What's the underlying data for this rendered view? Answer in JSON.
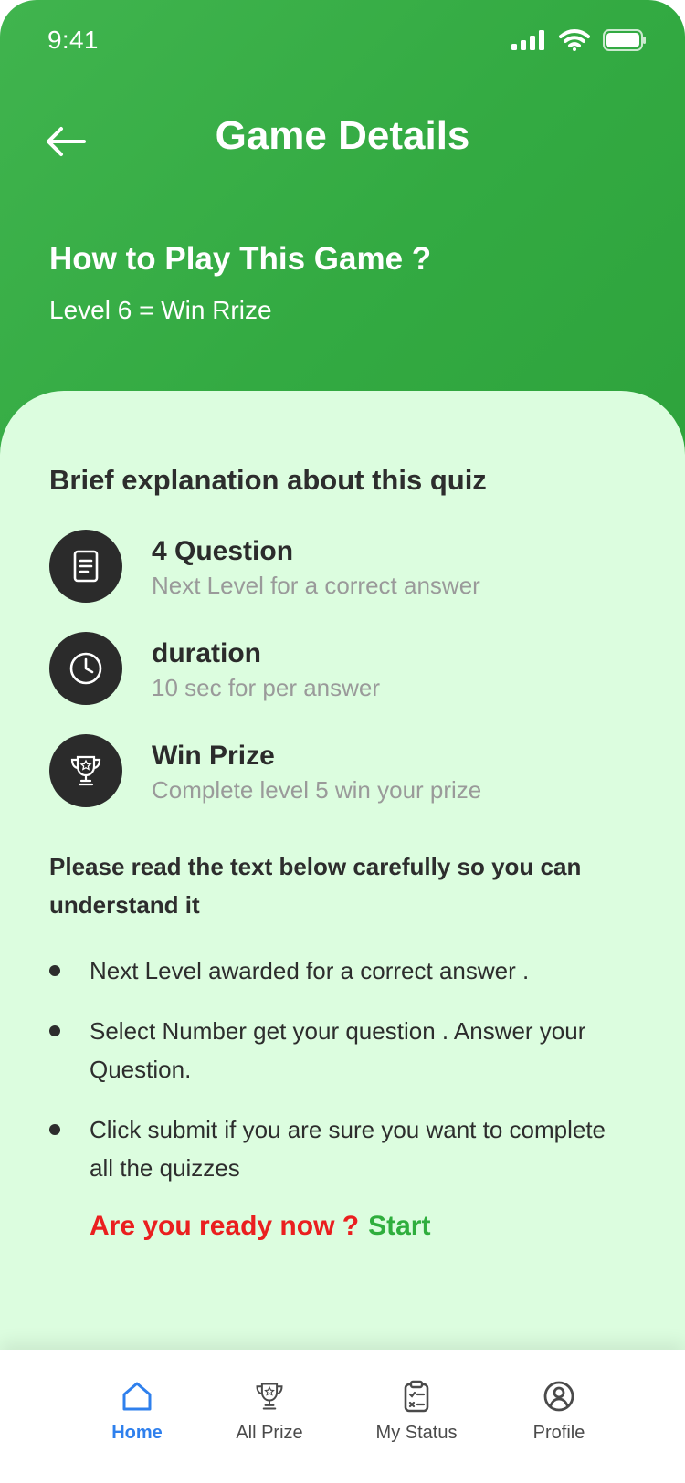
{
  "status_bar": {
    "time": "9:41",
    "icons": [
      "signal-icon",
      "wifi-icon",
      "battery-icon"
    ]
  },
  "header": {
    "back_icon": "arrow-left-icon",
    "title": "Game Details"
  },
  "hero": {
    "title": "How to Play This Game ?",
    "subtitle": "Level 6 = Win Rrize"
  },
  "content": {
    "section_title": "Brief explanation about this quiz",
    "features": [
      {
        "icon": "document-icon",
        "title": "4 Question",
        "description": "Next Level  for a correct answer"
      },
      {
        "icon": "clock-icon",
        "title": "duration",
        "description": "10 sec for per answer"
      },
      {
        "icon": "trophy-icon",
        "title": "Win Prize",
        "description": "Complete level 5 win your prize"
      }
    ],
    "rules_intro": "Please read the text below carefully so you can understand it",
    "rules": [
      "Next Level awarded for a correct answer .",
      "Select Number get your question . Answer your Question.",
      "Click submit if you are sure you want to complete all the quizzes"
    ],
    "cta": {
      "question": "Are you ready now ?",
      "start": "Start"
    }
  },
  "bottom_nav": {
    "active": "Home",
    "items": [
      {
        "label": "Home",
        "icon": "home-icon"
      },
      {
        "label": "All Prize",
        "icon": "trophy-icon"
      },
      {
        "label": "My Status",
        "icon": "clipboard-icon"
      },
      {
        "label": "Profile",
        "icon": "user-circle-icon"
      }
    ]
  },
  "colors": {
    "header_green": "#33aa42",
    "card_background": "#dcfddf",
    "icon_circle": "#2b2b2b",
    "cta_red": "#ea1f1f",
    "cta_green": "#2fae3d",
    "active_tab": "#2f80ed"
  }
}
